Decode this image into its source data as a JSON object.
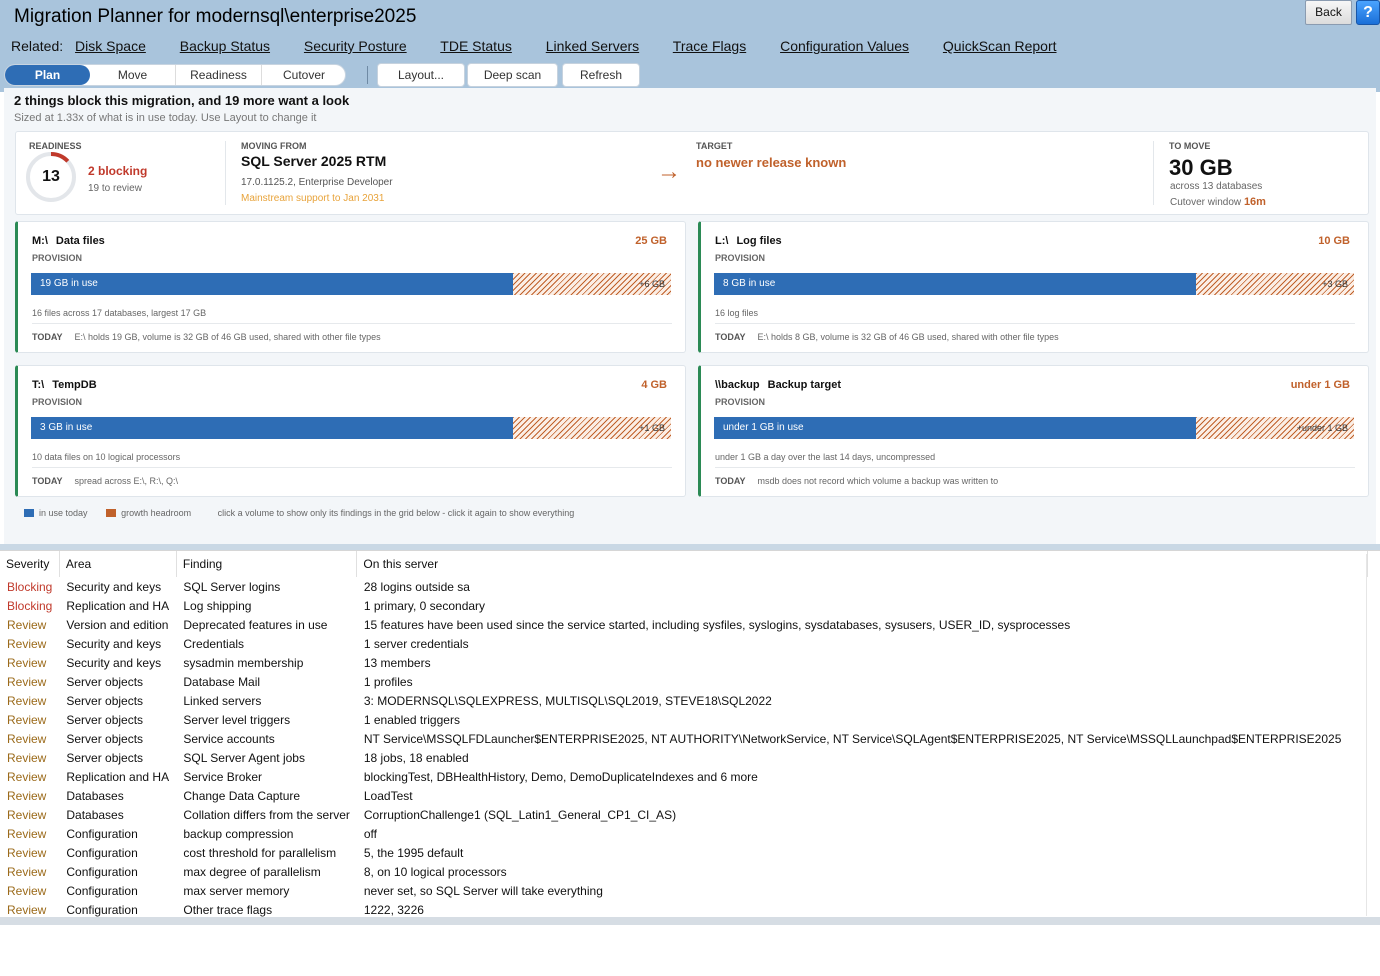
{
  "app": {
    "title": "Migration Planner for modernsql\\enterprise2025",
    "back_label": "Back",
    "help_icon": "?"
  },
  "related": {
    "label": "Related:",
    "links": [
      "Disk Space",
      "Backup Status",
      "Security Posture",
      "TDE Status",
      "Linked Servers",
      "Trace Flags",
      "Configuration Values",
      "QuickScan Report"
    ]
  },
  "tabs": [
    "Plan",
    "Move",
    "Readiness",
    "Cutover"
  ],
  "active_tab": "Plan",
  "toolbar": {
    "layout": "Layout...",
    "deep_scan": "Deep scan",
    "refresh": "Refresh"
  },
  "summary": {
    "headline": "2 things block this migration, and 19 more want a look",
    "subline": "Sized at 1.33x of what is in use today. Use Layout to change it",
    "readiness": {
      "caption": "READINESS",
      "score": "13",
      "score_fraction": 0.13,
      "blocking": "2 blocking",
      "review": "19 to review"
    },
    "moving_from": {
      "caption": "MOVING FROM",
      "name": "SQL Server 2025 RTM",
      "version": "17.0.1125.2, Enterprise Developer",
      "support": "Mainstream support to Jan 2031"
    },
    "target": {
      "caption": "TARGET",
      "value": "no newer release known",
      "arrow_icon": "right-arrow-icon"
    },
    "to_move": {
      "caption": "TO MOVE",
      "size": "30 GB",
      "sub": "across 13 databases",
      "cutover_label": "Cutover window",
      "cutover_value": "16m"
    }
  },
  "volumes": [
    {
      "drive": "M:\\",
      "name": "Data files",
      "size": "25 GB",
      "provision": "PROVISION",
      "used_label": "19 GB in use",
      "used_fraction": 0.753,
      "headroom_label": "+6 GB",
      "note": "16 files across 17 databases, largest 17 GB",
      "today_label": "TODAY",
      "today": "E:\\ holds 19 GB, volume is 32 GB of 46 GB used, shared with other file types"
    },
    {
      "drive": "L:\\",
      "name": "Log files",
      "size": "10 GB",
      "provision": "PROVISION",
      "used_label": "8 GB in use",
      "used_fraction": 0.753,
      "headroom_label": "+3 GB",
      "note": "16 log files",
      "today_label": "TODAY",
      "today": "E:\\ holds 8 GB, volume is 32 GB of 46 GB used, shared with other file types"
    },
    {
      "drive": "T:\\",
      "name": "TempDB",
      "size": "4 GB",
      "provision": "PROVISION",
      "used_label": "3 GB in use",
      "used_fraction": 0.753,
      "headroom_label": "+1 GB",
      "note": "10 data files on 10 logical processors",
      "today_label": "TODAY",
      "today": "spread across E:\\, R:\\, Q:\\"
    },
    {
      "drive": "\\\\backup",
      "name": "Backup target",
      "size": "under 1 GB",
      "provision": "PROVISION",
      "used_label": "under 1 GB in use",
      "used_fraction": 0.753,
      "headroom_label": "+under 1 GB",
      "note": "under 1 GB a day over the last 14 days, uncompressed",
      "today_label": "TODAY",
      "today": "msdb does not record which volume a backup was written to"
    }
  ],
  "legend": {
    "in_use": "in use today",
    "headroom": "growth headroom",
    "hint": "click a volume to show only its findings in the grid below - click it again to show everything"
  },
  "colors": {
    "in_use": "#2e6db5",
    "headroom": "#c0612b",
    "blocking": "#c0392b",
    "review": "#9b6a1a",
    "accent_border": "#2b8a55"
  },
  "grid": {
    "columns": [
      "Severity",
      "Area",
      "Finding",
      "On this server"
    ],
    "rows": [
      [
        "Blocking",
        "Security and keys",
        "SQL Server logins",
        "28 logins outside sa"
      ],
      [
        "Blocking",
        "Replication and HA",
        "Log shipping",
        "1 primary, 0 secondary"
      ],
      [
        "Review",
        "Version and edition",
        "Deprecated features in use",
        "15 features have been used since the service started, including sysfiles, syslogins, sysdatabases, sysusers, USER_ID, sysprocesses"
      ],
      [
        "Review",
        "Security and keys",
        "Credentials",
        "1 server credentials"
      ],
      [
        "Review",
        "Security and keys",
        "sysadmin membership",
        "13 members"
      ],
      [
        "Review",
        "Server objects",
        "Database Mail",
        "1 profiles"
      ],
      [
        "Review",
        "Server objects",
        "Linked servers",
        "3: MODERNSQL\\SQLEXPRESS, MULTISQL\\SQL2019, STEVE18\\SQL2022"
      ],
      [
        "Review",
        "Server objects",
        "Server level triggers",
        "1 enabled triggers"
      ],
      [
        "Review",
        "Server objects",
        "Service accounts",
        "NT Service\\MSSQLFDLauncher$ENTERPRISE2025, NT AUTHORITY\\NetworkService, NT Service\\SQLAgent$ENTERPRISE2025, NT Service\\MSSQLLaunchpad$ENTERPRISE2025"
      ],
      [
        "Review",
        "Server objects",
        "SQL Server Agent jobs",
        "18 jobs, 18 enabled"
      ],
      [
        "Review",
        "Replication and HA",
        "Service Broker",
        "blockingTest, DBHealthHistory, Demo, DemoDuplicateIndexes and 6 more"
      ],
      [
        "Review",
        "Databases",
        "Change Data Capture",
        "LoadTest"
      ],
      [
        "Review",
        "Databases",
        "Collation differs from the server",
        "CorruptionChallenge1 (SQL_Latin1_General_CP1_CI_AS)"
      ],
      [
        "Review",
        "Configuration",
        "backup compression",
        "off"
      ],
      [
        "Review",
        "Configuration",
        "cost threshold for parallelism",
        "5, the 1995 default"
      ],
      [
        "Review",
        "Configuration",
        "max degree of parallelism",
        "8, on 10 logical processors"
      ],
      [
        "Review",
        "Configuration",
        "max server memory",
        "never set, so SQL Server will take everything"
      ],
      [
        "Review",
        "Configuration",
        "Other trace flags",
        "1222, 3226"
      ]
    ]
  }
}
